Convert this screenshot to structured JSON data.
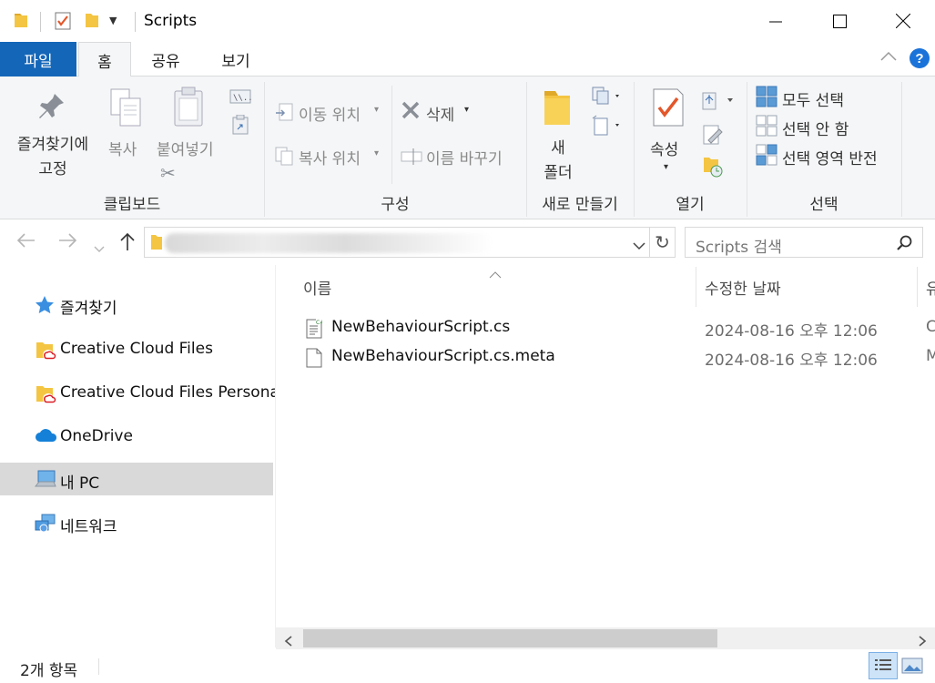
{
  "window": {
    "title": "Scripts",
    "controls": {
      "minimize": "minimize",
      "maximize": "maximize",
      "close": "close"
    }
  },
  "tabs": [
    {
      "label": "파일",
      "active": false
    },
    {
      "label": "홈",
      "active": true
    },
    {
      "label": "공유",
      "active": false
    },
    {
      "label": "보기",
      "active": false
    }
  ],
  "ribbon": {
    "clipboard": {
      "pin_label_1": "즐겨찾기에",
      "pin_label_2": "고정",
      "copy_label": "복사",
      "paste_label": "붙여넣기",
      "group_label": "클립보드"
    },
    "organize": {
      "move_to": "이동 위치",
      "copy_to": "복사 위치",
      "delete": "삭제",
      "rename": "이름 바꾸기",
      "group_label": "구성"
    },
    "new": {
      "new_folder_1": "새",
      "new_folder_2": "폴더",
      "group_label": "새로 만들기"
    },
    "open": {
      "properties": "속성",
      "group_label": "열기"
    },
    "select": {
      "select_all": "모두 선택",
      "select_none": "선택 안 함",
      "invert": "선택 영역 반전",
      "group_label": "선택"
    }
  },
  "address": {
    "search_placeholder": "Scripts 검색"
  },
  "nav": {
    "items": [
      {
        "label": "즐겨찾기",
        "icon": "star-icon"
      },
      {
        "label": "Creative Cloud Files",
        "icon": "creative-cloud-folder-icon"
      },
      {
        "label": "Creative Cloud Files Personal",
        "icon": "creative-cloud-folder-icon"
      },
      {
        "label": "OneDrive",
        "icon": "onedrive-cloud-icon"
      },
      {
        "label": "내 PC",
        "icon": "computer-icon",
        "selected": true
      },
      {
        "label": "네트워크",
        "icon": "network-icon"
      }
    ]
  },
  "filelist": {
    "columns": {
      "name": "이름",
      "modified": "수정한 날짜",
      "type": "유"
    },
    "rows": [
      {
        "name": "NewBehaviourScript.cs",
        "modified": "2024-08-16 오후 12:06",
        "type": "C",
        "icon": "cs-script-file-icon"
      },
      {
        "name": "NewBehaviourScript.cs.meta",
        "modified": "2024-08-16 오후 12:06",
        "type": "M",
        "icon": "blank-file-icon"
      }
    ]
  },
  "status": {
    "item_count": "2개 항목"
  },
  "colors": {
    "file_tab": "#1466b8",
    "ribbon_bg": "#f5f6f7",
    "selected_nav": "#d9d9d9",
    "folder_yellow": "#f4c542",
    "check_orange": "#e2572b",
    "help_blue": "#1a73d9"
  }
}
